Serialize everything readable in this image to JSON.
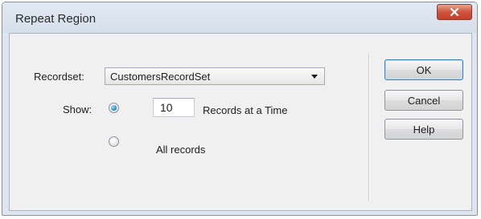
{
  "window": {
    "title": "Repeat Region"
  },
  "form": {
    "recordset_label": "Recordset:",
    "recordset_value": "CustomersRecordSet",
    "show_label": "Show:",
    "records_count": "10",
    "records_at_a_time_label": "Records at a Time",
    "all_records_label": "All records",
    "selected_option": "records_at_a_time"
  },
  "buttons": {
    "ok": "OK",
    "cancel": "Cancel",
    "help": "Help"
  },
  "icons": {
    "close": "close-icon",
    "dropdown": "chevron-down-icon"
  },
  "colors": {
    "close_button": "#c94a33",
    "radio_selected": "#2a8fc9"
  }
}
